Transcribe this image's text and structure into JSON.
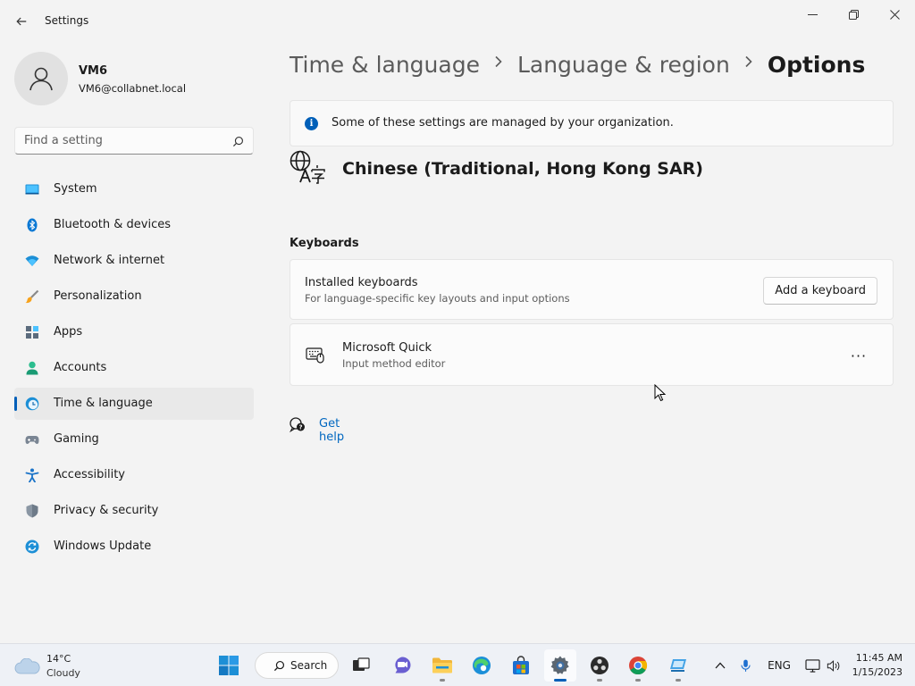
{
  "window": {
    "title": "Settings"
  },
  "user": {
    "name": "VM6",
    "email": "VM6@collabnet.local"
  },
  "search": {
    "placeholder": "Find a setting"
  },
  "sidebar": {
    "items": [
      {
        "label": "System",
        "icon": "system-icon"
      },
      {
        "label": "Bluetooth & devices",
        "icon": "bluetooth-icon"
      },
      {
        "label": "Network & internet",
        "icon": "wifi-icon"
      },
      {
        "label": "Personalization",
        "icon": "brush-icon"
      },
      {
        "label": "Apps",
        "icon": "apps-icon"
      },
      {
        "label": "Accounts",
        "icon": "accounts-icon"
      },
      {
        "label": "Time & language",
        "icon": "clock-globe-icon",
        "active": true
      },
      {
        "label": "Gaming",
        "icon": "gamepad-icon"
      },
      {
        "label": "Accessibility",
        "icon": "accessibility-icon"
      },
      {
        "label": "Privacy & security",
        "icon": "shield-icon"
      },
      {
        "label": "Windows Update",
        "icon": "update-icon"
      }
    ]
  },
  "breadcrumb": {
    "items": [
      "Time & language",
      "Language & region",
      "Options"
    ]
  },
  "info": {
    "text": "Some of these settings are managed by your organization."
  },
  "language": {
    "name": "Chinese (Traditional, Hong Kong SAR)"
  },
  "keyboards": {
    "section_title": "Keyboards",
    "installed": {
      "title": "Installed keyboards",
      "subtitle": "For language-specific key layouts and input options",
      "button": "Add a keyboard"
    },
    "items": [
      {
        "title": "Microsoft Quick",
        "subtitle": "Input method editor",
        "more": "···"
      }
    ]
  },
  "help": {
    "label": "Get help"
  },
  "taskbar": {
    "weather": {
      "temp": "14°C",
      "condition": "Cloudy"
    },
    "search_label": "Search",
    "tray": {
      "lang": "ENG"
    },
    "clock": {
      "time": "11:45 AM",
      "date": "1/15/2023"
    }
  },
  "colors": {
    "accent": "#005fb8",
    "link": "#0067c0",
    "background": "#f3f3f3"
  }
}
